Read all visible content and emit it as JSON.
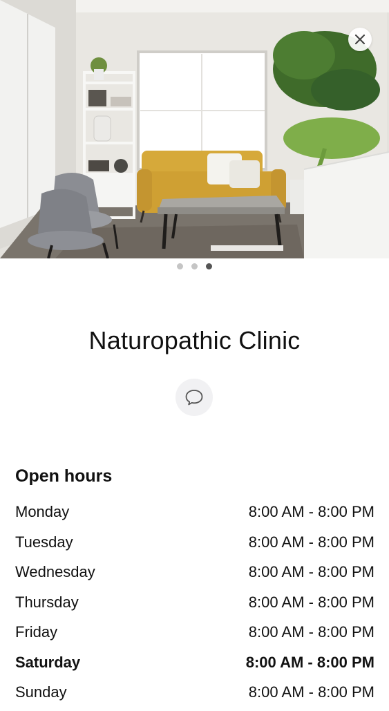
{
  "header": {
    "close_icon": "close-icon",
    "carousel_pages": 3,
    "carousel_active_index": 2
  },
  "clinic": {
    "name": "Naturopathic Clinic",
    "contact_icon": "chat-bubble-icon"
  },
  "hours": {
    "heading": "Open hours",
    "rows": [
      {
        "day": "Monday",
        "time": "8:00 AM - 8:00 PM"
      },
      {
        "day": "Tuesday",
        "time": "8:00 AM - 8:00 PM"
      },
      {
        "day": "Wednesday",
        "time": "8:00 AM - 8:00 PM"
      },
      {
        "day": "Thursday",
        "time": "8:00 AM - 8:00 PM"
      },
      {
        "day": "Friday",
        "time": "8:00 AM - 8:00 PM"
      },
      {
        "day": "Saturday",
        "time": "8:00 AM - 8:00 PM",
        "today": true
      },
      {
        "day": "Sunday",
        "time": "8:00 AM - 8:00 PM"
      }
    ]
  },
  "colors": {
    "dot_inactive": "#c5c5c5",
    "dot_active": "#555555",
    "sofa": "#d6a93a"
  }
}
